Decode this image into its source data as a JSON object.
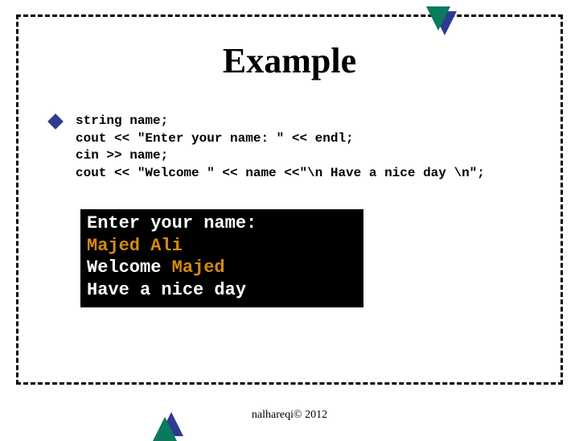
{
  "title": "Example",
  "code": {
    "line1": "string name;",
    "line2": "cout << \"Enter your name: \" << endl;",
    "line3": "cin >> name;",
    "line4": "cout << \"Welcome \" << name <<\"\\n Have a nice day \\n\";"
  },
  "console": {
    "line1": "Enter your name:",
    "line2": "Majed Ali",
    "line3a": "Welcome ",
    "line3b": "Majed",
    "line4": "Have a nice day"
  },
  "footer": "nalhareqi© 2012"
}
